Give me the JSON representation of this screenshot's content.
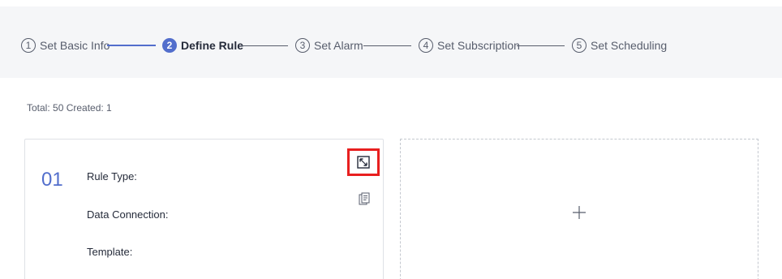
{
  "steps": [
    {
      "number": "1",
      "label": "Set Basic Info"
    },
    {
      "number": "2",
      "label": "Define Rule"
    },
    {
      "number": "3",
      "label": "Set Alarm"
    },
    {
      "number": "4",
      "label": "Set Subscription"
    },
    {
      "number": "5",
      "label": "Set Scheduling"
    }
  ],
  "summary": "Total: 50 Created: 1",
  "card": {
    "index": "01",
    "fields": {
      "rule_type": "Rule Type:",
      "data_connection": "Data Connection:",
      "template": "Template:"
    }
  },
  "add_card": {
    "icon": "plus-icon"
  },
  "colors": {
    "accent": "#526ecc",
    "highlight": "#e81f1f",
    "stepper_bg": "#f5f6f8"
  }
}
